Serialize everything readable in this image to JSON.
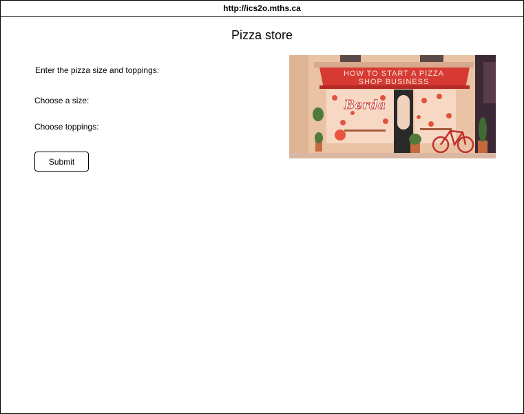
{
  "browser": {
    "url": "http://ics2o.mths.ca"
  },
  "page": {
    "title": "Pizza store"
  },
  "form": {
    "instructions": "Enter the pizza size and toppings:",
    "size_label": "Choose a size:",
    "toppings_label": "Choose toppings:",
    "submit_label": "Submit"
  },
  "image": {
    "banner_line1": "HOW TO START A PIZZA",
    "banner_line2": "SHOP BUSINESS",
    "sign_text": "Berda"
  }
}
